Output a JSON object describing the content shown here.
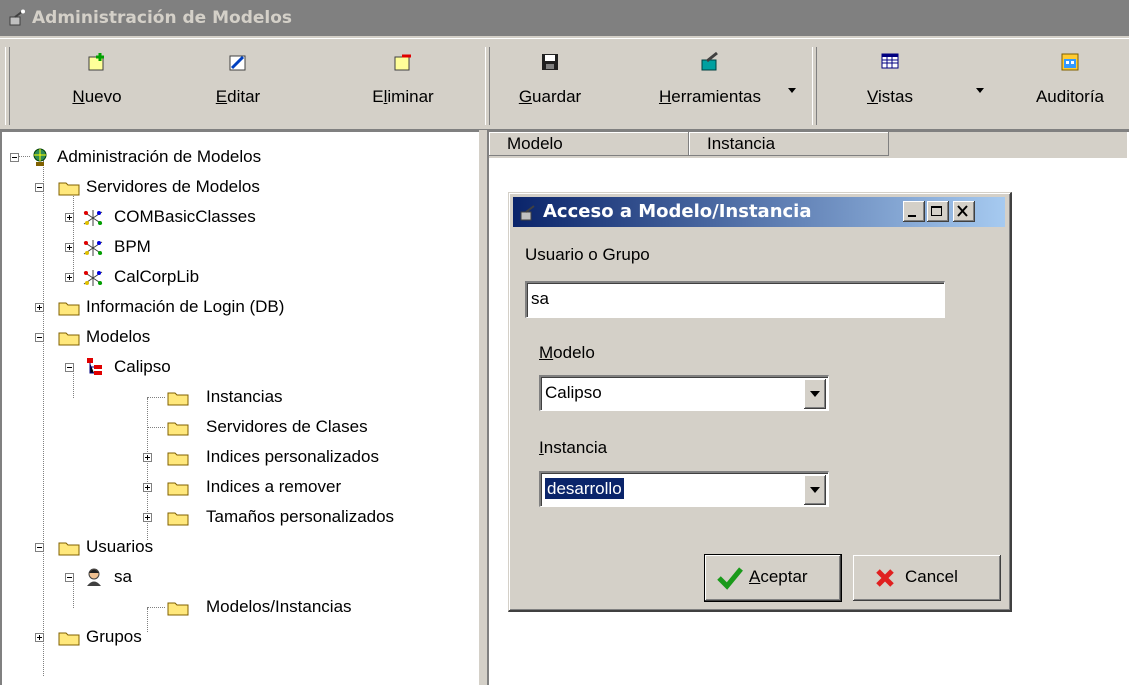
{
  "window": {
    "title": "Administración de Modelos",
    "icon": "app-icon"
  },
  "toolbar": {
    "buttons": [
      {
        "pre": "",
        "u": "N",
        "post": "uevo",
        "icon": "new-icon"
      },
      {
        "pre": "",
        "u": "E",
        "post": "ditar",
        "icon": "edit-icon"
      },
      {
        "pre": "E",
        "u": "l",
        "post": "iminar",
        "icon": "delete-icon"
      },
      {
        "pre": "",
        "u": "G",
        "post": "uardar",
        "icon": "save-icon"
      },
      {
        "pre": "",
        "u": "H",
        "post": "erramientas",
        "icon": "tools-icon"
      },
      {
        "pre": "",
        "u": "V",
        "post": "istas",
        "icon": "views-icon"
      },
      {
        "pre": "",
        "u": "",
        "post": "Auditoría",
        "icon": "audit-icon"
      }
    ]
  },
  "tree": {
    "root": "Administración de Modelos",
    "servidores": "Servidores de Modelos",
    "srv1": "COMBasicClasses",
    "srv2": "BPM",
    "srv3": "CalCorpLib",
    "login": "Información de Login (DB)",
    "modelos": "Modelos",
    "calipso": "Calipso",
    "instancias": "Instancias",
    "servclases": "Servidores de Clases",
    "idxpers": "Indices personalizados",
    "idxrem": "Indices a remover",
    "tampers": "Tamaños personalizados",
    "usuarios": "Usuarios",
    "sa": "sa",
    "modinst": "Modelos/Instancias",
    "grupos": "Grupos"
  },
  "grid": {
    "columns": [
      "Modelo",
      "Instancia"
    ]
  },
  "dialog": {
    "title": "Acceso a Modelo/Instancia",
    "user_label": "Usuario o Grupo",
    "user_value": "sa",
    "model_label_u": "M",
    "model_label_rest": "odelo",
    "model_value": "Calipso",
    "instance_label_u": "I",
    "instance_label_rest": "nstancia",
    "instance_value": "desarrollo",
    "ok_u": "A",
    "ok_rest": "ceptar",
    "cancel_label": "Cancel"
  },
  "colors": {
    "selection": "#0a246a",
    "titlebar_inactive": "#808080",
    "face": "#d4d0c8"
  }
}
